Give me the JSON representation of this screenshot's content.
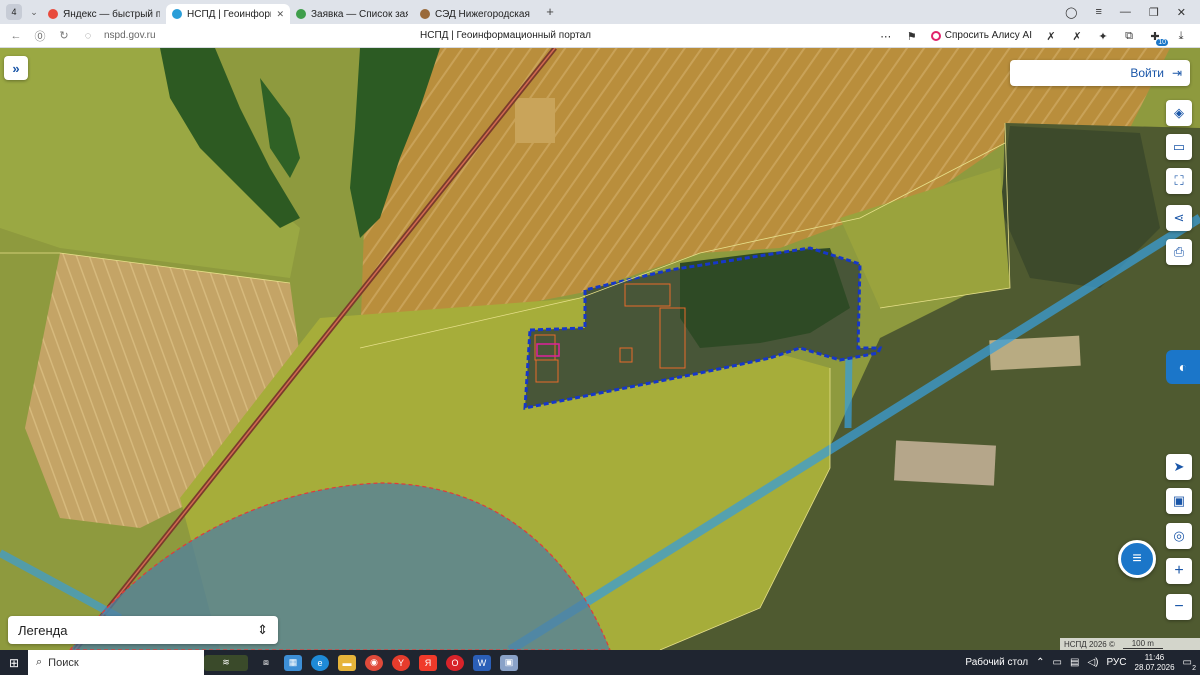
{
  "browser": {
    "tab_count": "4",
    "tabs": [
      {
        "title": "Яндекс — быстрый поиск",
        "color": "#e84a3c"
      },
      {
        "title": "НСПД | Геоинформационный",
        "color": "#2a9ed8"
      },
      {
        "title": "Заявка — Список заявок",
        "color": "#3f9e4b"
      },
      {
        "title": "СЭД Нижегородская обл",
        "color": "#9a6a3a"
      }
    ],
    "url": "nspd.gov.ru",
    "page_title": "НСПД | Геоинформационный портал",
    "alice_label": "Спросить Алису AI",
    "ext_badge": "10"
  },
  "map": {
    "login_label": "Войти",
    "legend_label": "Легенда",
    "attribution": "НСПД 2026 ©",
    "scale_label": "100 m",
    "controls": [
      {
        "name": "layers-icon",
        "glyph": "◈"
      },
      {
        "name": "ruler-icon",
        "glyph": "▭"
      },
      {
        "name": "select-area-icon",
        "glyph": "⛶"
      },
      {
        "name": "share-icon",
        "glyph": "⋖"
      },
      {
        "name": "print-icon",
        "glyph": "⎙"
      }
    ],
    "lower_controls": [
      {
        "name": "locate-icon",
        "glyph": "➤"
      },
      {
        "name": "minimap-icon",
        "glyph": "▣"
      },
      {
        "name": "geo-search-icon",
        "glyph": "◎"
      },
      {
        "name": "zoom-in-icon",
        "glyph": "+"
      },
      {
        "name": "zoom-out-icon",
        "glyph": "−"
      }
    ]
  },
  "taskbar": {
    "search_label": "Поиск",
    "desktop_label": "Рабочий стол",
    "lang": "РУС",
    "time": "11:46",
    "date": "28.07.2026",
    "notifications": "2"
  }
}
